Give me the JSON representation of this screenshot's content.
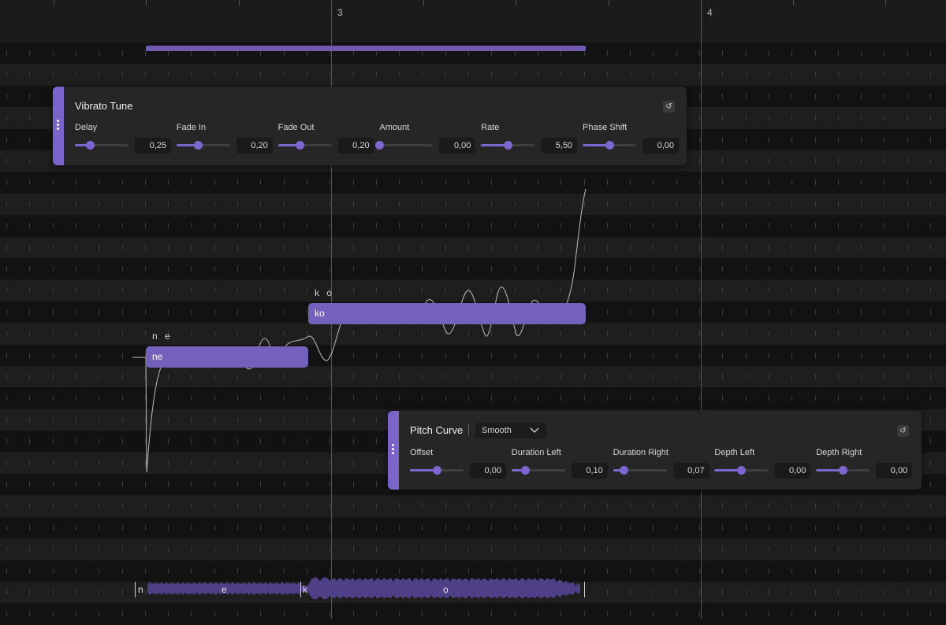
{
  "timeline": {
    "bars": [
      "3",
      "4"
    ]
  },
  "vibrato_panel": {
    "title": "Vibrato Tune",
    "reset_icon": "reset-icon",
    "params": [
      {
        "label": "Delay",
        "value": "0,25",
        "level": 0.28
      },
      {
        "label": "Fade In",
        "value": "0,20",
        "level": 0.4
      },
      {
        "label": "Fade Out",
        "value": "0,20",
        "level": 0.4
      },
      {
        "label": "Amount",
        "value": "0,00",
        "level": 0.0
      },
      {
        "label": "Rate",
        "value": "5,50",
        "level": 0.5
      },
      {
        "label": "Phase Shift",
        "value": "0,00",
        "level": 0.5
      }
    ]
  },
  "pitch_panel": {
    "title": "Pitch Curve",
    "mode": "Smooth",
    "reset_icon": "reset-icon",
    "params": [
      {
        "label": "Offset",
        "value": "0,00",
        "level": 0.5
      },
      {
        "label": "Duration Left",
        "value": "0,10",
        "level": 0.25
      },
      {
        "label": "Duration Right",
        "value": "0,07",
        "level": 0.2
      },
      {
        "label": "Depth Left",
        "value": "0,00",
        "level": 0.5
      },
      {
        "label": "Depth Right",
        "value": "0,00",
        "level": 0.5
      }
    ]
  },
  "notes": [
    {
      "lyric": "ne",
      "phonemes": "n e"
    },
    {
      "lyric": "ko",
      "phonemes": "k o"
    }
  ],
  "waveform": {
    "phonemes": [
      "n",
      "e",
      "k",
      "o"
    ]
  },
  "colors": {
    "accent": "#7d66cf",
    "note": "#7460bd",
    "background": "#1b1b1b"
  }
}
